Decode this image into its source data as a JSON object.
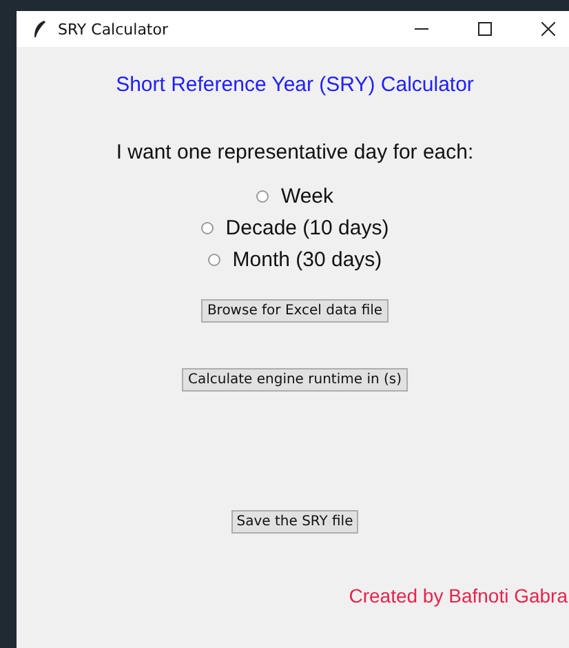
{
  "window": {
    "title": "SRY Calculator"
  },
  "heading": "Short Reference Year (SRY) Calculator",
  "prompt": "I want one representative day for each:",
  "options": [
    {
      "label": "Week",
      "selected": false
    },
    {
      "label": "Decade (10 days)",
      "selected": false
    },
    {
      "label": "Month (30 days)",
      "selected": false
    }
  ],
  "buttons": [
    "Browse for Excel data file",
    "Calculate engine runtime in (s)",
    "Save the SRY file"
  ],
  "credit": "Created by Bafnoti Gabra"
}
